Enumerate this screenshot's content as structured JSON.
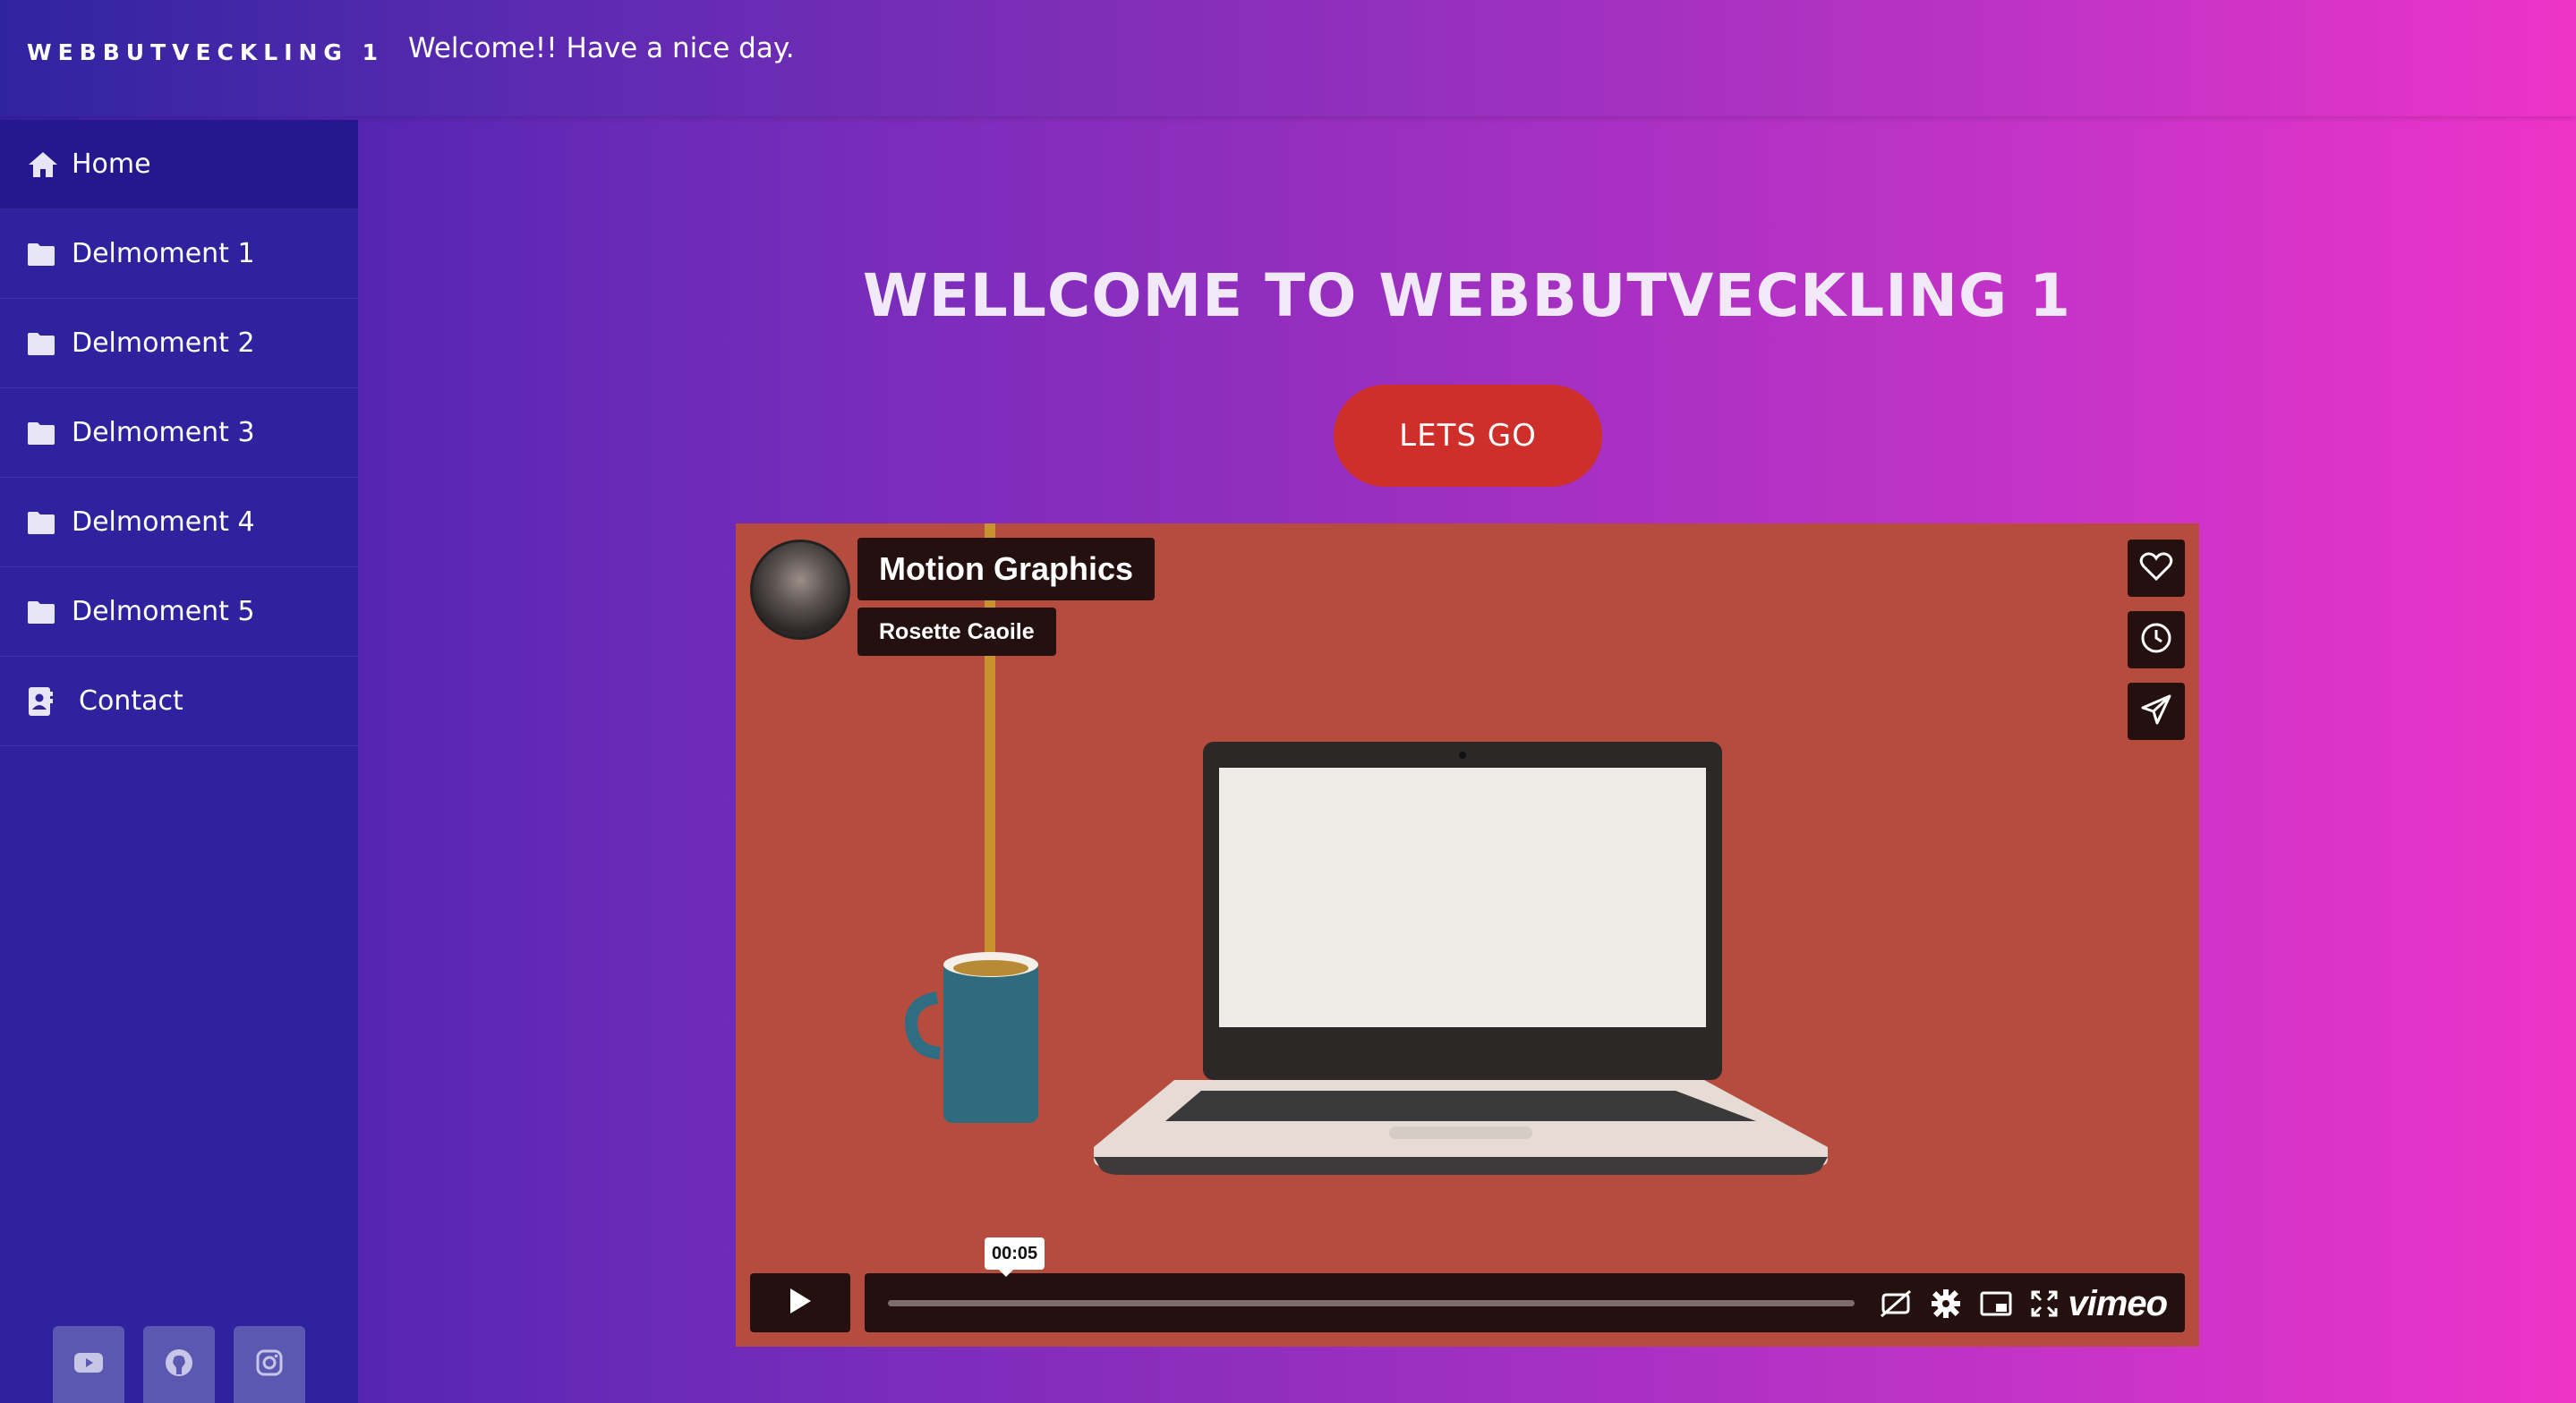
{
  "header": {
    "brand": "WEBBUTVECKLING 1",
    "welcome": "Welcome!! Have a nice day."
  },
  "sidebar": {
    "items": [
      {
        "label": "Home",
        "icon": "home-icon",
        "active": true
      },
      {
        "label": "Delmoment 1",
        "icon": "folder-icon"
      },
      {
        "label": "Delmoment 2",
        "icon": "folder-icon"
      },
      {
        "label": "Delmoment 3",
        "icon": "folder-icon"
      },
      {
        "label": "Delmoment 4",
        "icon": "folder-icon"
      },
      {
        "label": "Delmoment 5",
        "icon": "folder-icon"
      },
      {
        "label": "Contact",
        "icon": "contact-book-icon"
      }
    ],
    "socials": [
      "youtube-icon",
      "github-icon",
      "instagram-icon"
    ]
  },
  "main": {
    "title": "WELLCOME TO WEBBUTVECKLING 1",
    "cta_label": "LETS GO"
  },
  "video": {
    "title": "Motion Graphics",
    "author": "Rosette Caoile",
    "time_tooltip": "00:05",
    "logo": "vimeo",
    "background_color": "#b54c3e",
    "side_buttons": [
      "heart-icon",
      "clock-icon",
      "send-icon"
    ],
    "control_icons": [
      "captions-off-icon",
      "settings-icon",
      "picture-in-picture-icon",
      "fullscreen-icon"
    ]
  },
  "colors": {
    "sidebar": "#2e229e",
    "cta": "#cf2f2a",
    "gradient_start": "#3a1fa8",
    "gradient_end": "#ee33c8"
  }
}
